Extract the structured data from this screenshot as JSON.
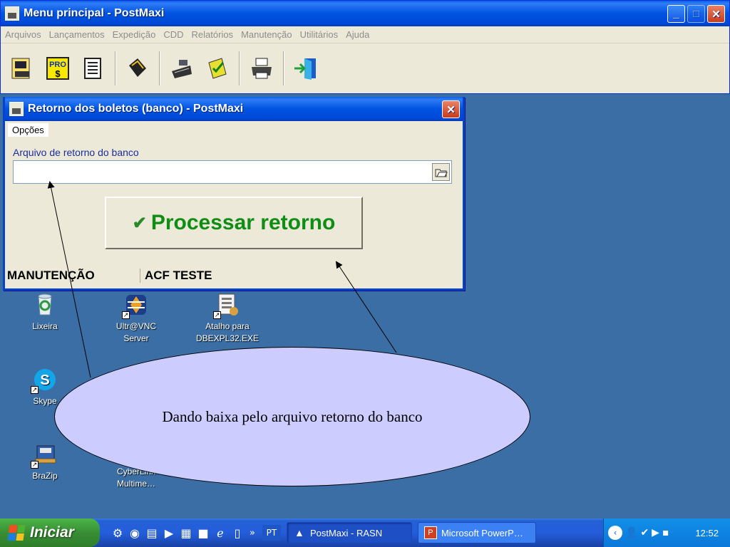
{
  "main_window": {
    "title": "Menu principal - PostMaxi",
    "menu": [
      "Arquivos",
      "Lançamentos",
      "Expedição",
      "CDD",
      "Relatórios",
      "Manutenção",
      "Utilitários",
      "Ajuda"
    ],
    "toolbar_buttons": [
      {
        "icon": "document-viewer-icon",
        "glyph": "🖻"
      },
      {
        "icon": "pro-price-icon",
        "glyph": "PRO $"
      },
      {
        "icon": "printer-list-icon",
        "glyph": "🗎"
      },
      {
        "icon": "chip-icon",
        "glyph": "◆"
      },
      {
        "icon": "cash-register-icon",
        "glyph": "🖩"
      },
      {
        "icon": "notebook-check-icon",
        "glyph": "✎"
      },
      {
        "icon": "printer-icon",
        "glyph": "🖶"
      },
      {
        "icon": "exit-door-icon",
        "glyph": "⇥"
      }
    ]
  },
  "dialog": {
    "title": "Retorno dos boletos (banco) - PostMaxi",
    "menu_label": "Opções",
    "field_label": "Arquivo de retorno do banco",
    "field_value": "",
    "process_button_label": "Processar retorno",
    "status_left": "MANUTENÇÃO",
    "status_right": "ACF TESTE"
  },
  "desktop_icons": [
    {
      "label": "Lixeira",
      "icon": "recycle-bin-icon"
    },
    {
      "label": "Ultr@VNC Server",
      "icon": "vnc-server-icon"
    },
    {
      "label": "Atalho para DBEXPL32.EXE",
      "icon": "dbexpl-shortcut-icon"
    },
    {
      "label": "Skype",
      "icon": "skype-icon"
    },
    {
      "label": "BraZip",
      "icon": "brazip-icon"
    },
    {
      "label": "CyberLink Multime…",
      "icon": "cyberlink-icon"
    }
  ],
  "callout": {
    "text": "Dando baixa pelo arquivo retorno do banco"
  },
  "taskbar": {
    "start_label": "Iniciar",
    "language": "PT",
    "tasks": [
      {
        "label": "PostMaxi - RASN",
        "active": true
      },
      {
        "label": "Microsoft PowerP…",
        "active": false
      }
    ],
    "clock": "12:52"
  },
  "colors": {
    "desktop": "#3a6ea5",
    "titlebar": "#0053e1",
    "process_text": "#0f8d14",
    "callout_fill": "#ccccff"
  }
}
